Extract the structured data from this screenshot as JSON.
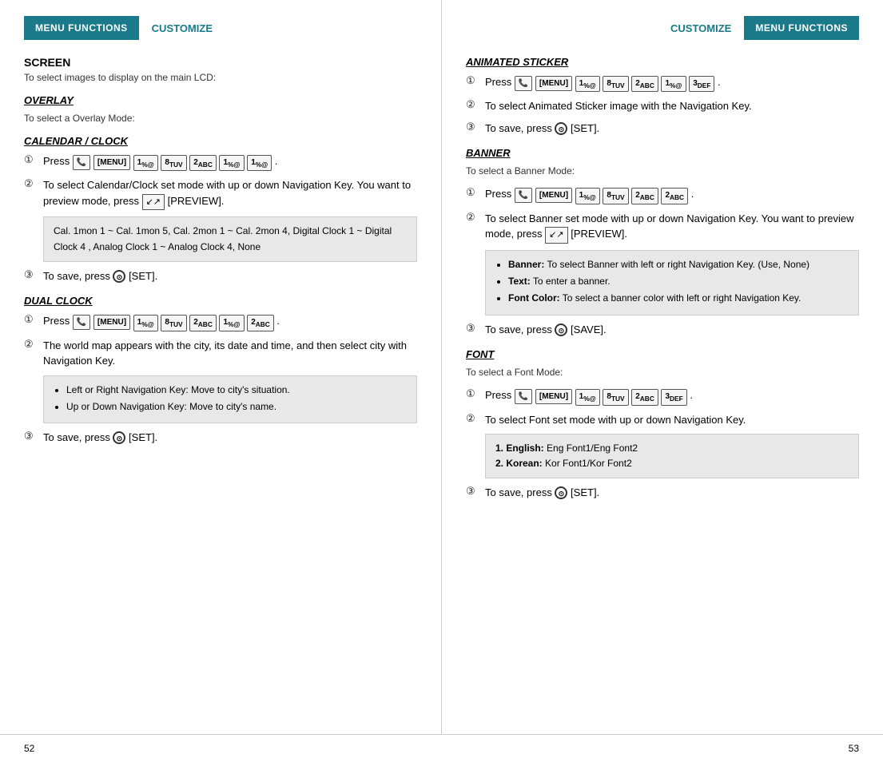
{
  "left": {
    "header": {
      "menu_functions": "MENU FUNCTIONS",
      "customize": "CUSTOMIZE"
    },
    "screen": {
      "title": "SCREEN",
      "subtitle": "To select images to display on the main LCD:"
    },
    "overlay": {
      "title": "OVERLAY",
      "subtitle": "To select a Overlay Mode:"
    },
    "calendar_clock": {
      "title": "CALENDAR / CLOCK",
      "step1_prefix": "Press",
      "step1_menu": "[MENU]",
      "step1_keys": [
        "1",
        "8TUV",
        "2ABC",
        "1",
        "1"
      ],
      "step2": "To select Calendar/Clock set mode with up or down Navigation Key. You want to preview mode, press",
      "step2_preview": "[PREVIEW].",
      "bullet": "Cal. 1mon 1 ~ Cal. 1mon 5, Cal. 2mon 1 ~ Cal. 2mon 4, Digital Clock 1 ~ Digital Clock 4 , Analog Clock 1 ~ Analog Clock 4, None",
      "step3": "To save, press",
      "step3_set": "[SET]."
    },
    "dual_clock": {
      "title": "DUAL CLOCK",
      "step1_prefix": "Press",
      "step1_menu": "[MENU]",
      "step1_keys": [
        "1",
        "8TUV",
        "2ABC",
        "1",
        "2ABC"
      ],
      "step2": "The world map appears with the city, its date and time, and then select city with Navigation Key.",
      "bullets": [
        "Left or Right Navigation Key: Move to city's situation.",
        "Up or Down Navigation Key: Move to city's name."
      ],
      "step3": "To save, press",
      "step3_set": "[SET]."
    },
    "page_num": "52"
  },
  "right": {
    "header": {
      "customize": "CUSTOMIZE",
      "menu_functions": "MENU FUNCTIONS"
    },
    "animated_sticker": {
      "title": "ANIMATED STICKER",
      "step1_prefix": "Press",
      "step1_menu": "[MENU]",
      "step1_keys": [
        "1",
        "8TUV",
        "2ABC",
        "1",
        "3DEF"
      ],
      "step2": "To select Animated Sticker image with the Navigation Key.",
      "step3": "To save, press",
      "step3_set": "[SET]."
    },
    "banner": {
      "title": "BANNER",
      "subtitle": "To select a Banner Mode:",
      "step1_prefix": "Press",
      "step1_menu": "[MENU]",
      "step1_keys": [
        "1",
        "8TUV",
        "2ABC",
        "2ABC"
      ],
      "step2": "To select Banner set mode with up or down Navigation Key. You want to preview mode, press",
      "step2_preview": "[PREVIEW].",
      "bullets": [
        {
          "bold": "Banner:",
          "text": " To select Banner with left or right Navigation Key. (Use, None)"
        },
        {
          "bold": "Text:",
          "text": " To enter a banner."
        },
        {
          "bold": "Font Color:",
          "text": " To select a banner color with left or right Navigation Key."
        }
      ],
      "step3": "To save, press",
      "step3_set": "[SAVE]."
    },
    "font": {
      "title": "FONT",
      "subtitle": "To select a Font Mode:",
      "step1_prefix": "Press",
      "step1_menu": "[MENU]",
      "step1_keys": [
        "1",
        "8TUV",
        "2ABC",
        "3DEF"
      ],
      "step2": "To select Font set mode with up or down Navigation Key.",
      "bullets": [
        {
          "num": "1.",
          "bold": "English:",
          "text": " Eng Font1/Eng Font2"
        },
        {
          "num": "2.",
          "bold": "Korean:",
          "text": " Kor Font1/Kor Font2"
        }
      ],
      "step3": "To save, press",
      "step3_set": "[SET]."
    },
    "page_num": "53"
  }
}
